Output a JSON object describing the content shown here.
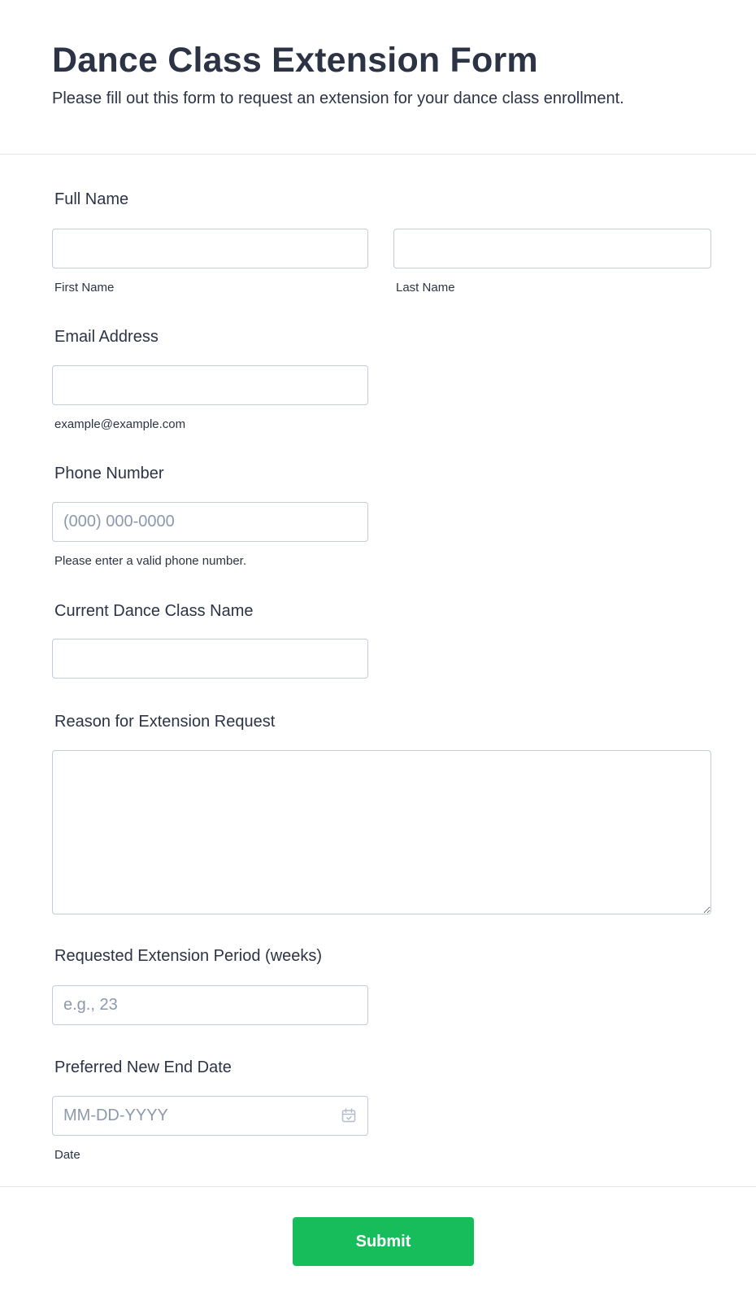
{
  "form": {
    "title": "Dance Class Extension Form",
    "description": "Please fill out this form to request an extension for your dance class enrollment."
  },
  "fields": {
    "full_name": {
      "label": "Full Name",
      "first_sublabel": "First Name",
      "last_sublabel": "Last Name",
      "first_value": "",
      "last_value": ""
    },
    "email": {
      "label": "Email Address",
      "value": "",
      "sublabel": "example@example.com"
    },
    "phone": {
      "label": "Phone Number",
      "placeholder": "(000) 000-0000",
      "sublabel": "Please enter a valid phone number."
    },
    "class_name": {
      "label": "Current Dance Class Name",
      "value": ""
    },
    "reason": {
      "label": "Reason for Extension Request",
      "value": ""
    },
    "period": {
      "label": "Requested Extension Period (weeks)",
      "placeholder": "e.g., 23"
    },
    "end_date": {
      "label": "Preferred New End Date",
      "placeholder": "MM-DD-YYYY",
      "sublabel": "Date",
      "icon": "calendar-icon"
    }
  },
  "submit": {
    "label": "Submit",
    "color": "#18bd5b"
  },
  "colors": {
    "text": "#2c3345",
    "border": "#c3cad8",
    "placeholder": "#8d98ad",
    "divider": "#e3e5ea"
  }
}
